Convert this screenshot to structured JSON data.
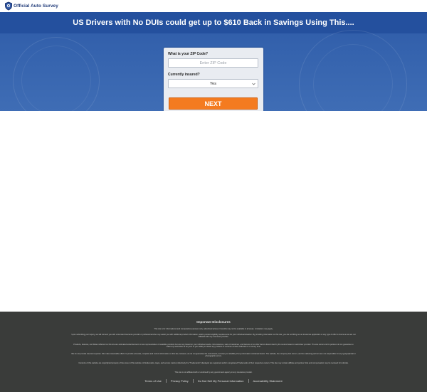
{
  "header": {
    "logo_text": "Official Auto Survey",
    "logo_icon": "shield-icon",
    "brand_color": "#1f3a78"
  },
  "hero": {
    "headline": "US Drivers with No DUIs could get up to $610 Back in Savings Using This....",
    "background_color": "#3462ad"
  },
  "form": {
    "zip_label": "What is your ZIP Code?",
    "zip_placeholder": "Enter ZIP Code",
    "zip_value": "",
    "insured_label": "Currently insured?",
    "insured_selected": "Yes",
    "insured_icon": "chevron-down-icon",
    "next_label": "NEXT",
    "next_color": "#f47b20"
  },
  "footer": {
    "title": "Important Disclosures",
    "background_color": "#3a3c3a",
    "paragraphs": [
      "This site is for informational and comparative purposes only; advertised prices or benefits may not be available in all areas. Limitations may apply.",
      "Upon submitting your inquiry, we will connect you with a licensed insurance provider or professional who may assist you with additional product information, and/or product eligibility requirements for your individual situation. By providing information on this site, you are not filling out an insurance application or any type of offer to insure as we are not affiliated with any insurance provider.",
      "Products, features, and Rates reflected on this site are estimated advertisements or are representative of available products but are very based on your individual needs, circumstances, state of residence, and features or to other factors determined by the source based on advertiser provider. The site owner and its partners do not guarantee to make any warranties of any sort of your ability to obtain any products or services at rates reflected on or at any time.",
      "We do not provide insurance quotes. We make reasonable efforts to provide accurate, complete and current information on this site, however, we do not guarantee the correctness, accuracy or reliability of any information contained herein. The website, the company that owns it, and its marketing partners are not responsible for any typographical or photographic errors.",
      "Contents of this website are copyrighted property of the owner of this website. All trademarks, logos, and service marks (collectively the \"Trademarks\") displayed are registered and/or unregistered Trademarks of their respective owners. This site may contain affiliate and partner links and compensation may be received for referrals.",
      "This site is not affiliated with or endorsed by any government agency or any insurance provider."
    ],
    "links": [
      "Terms of Use",
      "Privacy Policy",
      "Do Not Sell My Personal Information",
      "Accessibility Statement"
    ]
  }
}
